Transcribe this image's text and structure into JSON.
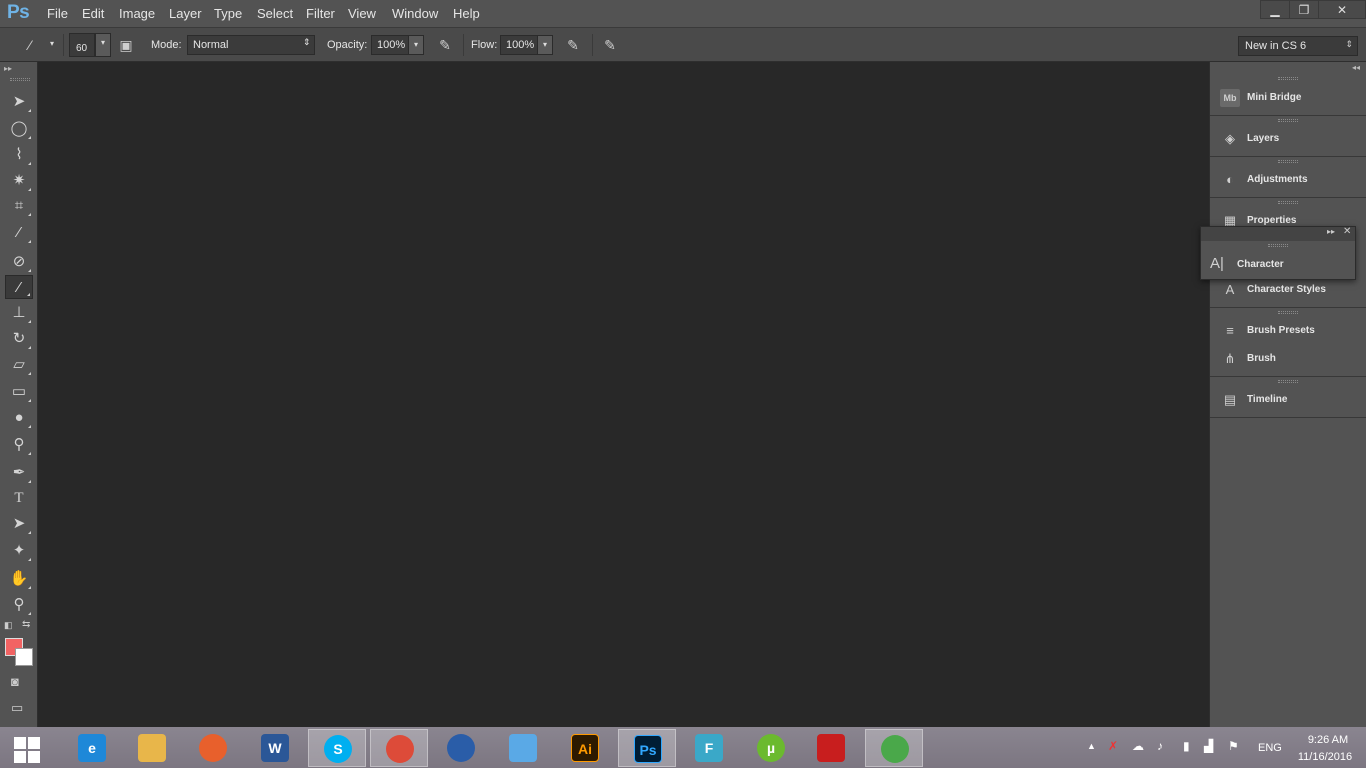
{
  "app": {
    "logo": "Ps"
  },
  "menu": [
    "File",
    "Edit",
    "Image",
    "Layer",
    "Type",
    "Select",
    "Filter",
    "View",
    "Window",
    "Help"
  ],
  "window_controls": {
    "minimize": "▁",
    "restore": "❐",
    "close": "✕"
  },
  "options_bar": {
    "brush_size": "60",
    "mode_label": "Mode:",
    "mode_value": "Normal",
    "opacity_label": "Opacity:",
    "opacity_value": "100%",
    "flow_label": "Flow:",
    "flow_value": "100%",
    "workspace": "New in CS 6"
  },
  "tools": [
    {
      "name": "move-tool",
      "icon": "move-icon",
      "glyph": "➤"
    },
    {
      "name": "marquee-tool",
      "icon": "elliptical-marquee-icon",
      "glyph": "◯"
    },
    {
      "name": "lasso-tool",
      "icon": "polygonal-lasso-icon",
      "glyph": "⌇"
    },
    {
      "name": "magic-wand-tool",
      "icon": "magic-wand-icon",
      "glyph": "✷"
    },
    {
      "name": "crop-tool",
      "icon": "crop-icon",
      "glyph": "⌗"
    },
    {
      "name": "eyedropper-tool",
      "icon": "eyedropper-icon",
      "glyph": "⁄"
    },
    {
      "name": "healing-brush-tool",
      "icon": "bandage-icon",
      "glyph": "⊘"
    },
    {
      "name": "brush-tool",
      "icon": "brush-icon",
      "glyph": "⁄"
    },
    {
      "name": "clone-stamp-tool",
      "icon": "stamp-icon",
      "glyph": "⊥"
    },
    {
      "name": "history-brush-tool",
      "icon": "history-brush-icon",
      "glyph": "↻"
    },
    {
      "name": "eraser-tool",
      "icon": "eraser-icon",
      "glyph": "▱"
    },
    {
      "name": "gradient-tool",
      "icon": "gradient-icon",
      "glyph": "▭"
    },
    {
      "name": "blur-tool",
      "icon": "drop-icon",
      "glyph": "●"
    },
    {
      "name": "dodge-tool",
      "icon": "dodge-icon",
      "glyph": "⚲"
    },
    {
      "name": "pen-tool",
      "icon": "pen-icon",
      "glyph": "✒"
    },
    {
      "name": "type-tool",
      "icon": "type-icon",
      "glyph": "T"
    },
    {
      "name": "path-selection-tool",
      "icon": "arrow-icon",
      "glyph": "➤"
    },
    {
      "name": "custom-shape-tool",
      "icon": "shape-icon",
      "glyph": "✦"
    },
    {
      "name": "hand-tool",
      "icon": "hand-icon",
      "glyph": "✋"
    },
    {
      "name": "zoom-tool",
      "icon": "zoom-icon",
      "glyph": "⚲"
    }
  ],
  "colors": {
    "foreground": "#f26363",
    "background": "#ffffff"
  },
  "panels": {
    "mini_bridge": "Mini Bridge",
    "layers": "Layers",
    "adjustments": "Adjustments",
    "properties": "Properties",
    "character": "Character",
    "character_styles": "Character Styles",
    "brush_presets": "Brush Presets",
    "brush": "Brush",
    "timeline": "Timeline"
  },
  "taskbar": {
    "apps": [
      {
        "name": "internet-explorer",
        "label": "e",
        "color": "#1e88d8"
      },
      {
        "name": "file-explorer",
        "label": "",
        "color": "#e8b64a"
      },
      {
        "name": "firefox",
        "label": "",
        "color": "#e8602c"
      },
      {
        "name": "word",
        "label": "W",
        "color": "#2b5797"
      },
      {
        "name": "skype",
        "label": "S",
        "color": "#00aff0"
      },
      {
        "name": "chrome",
        "label": "",
        "color": "#dd4b39"
      },
      {
        "name": "thunderbird",
        "label": "",
        "color": "#2a5da8"
      },
      {
        "name": "window-app",
        "label": "",
        "color": "#5aa9e6"
      },
      {
        "name": "illustrator",
        "label": "Ai",
        "color": "#2d1a00"
      },
      {
        "name": "photoshop",
        "label": "Ps",
        "color": "#001d34"
      },
      {
        "name": "f-app",
        "label": "F",
        "color": "#3aa8c8"
      },
      {
        "name": "utorrent",
        "label": "µ",
        "color": "#6bba2e"
      },
      {
        "name": "acrobat",
        "label": "",
        "color": "#c81e1e"
      },
      {
        "name": "globe-app",
        "label": "",
        "color": "#4aa84a"
      }
    ],
    "tray": {
      "language": "ENG",
      "time": "9:26 AM",
      "date": "11/16/2016"
    }
  }
}
